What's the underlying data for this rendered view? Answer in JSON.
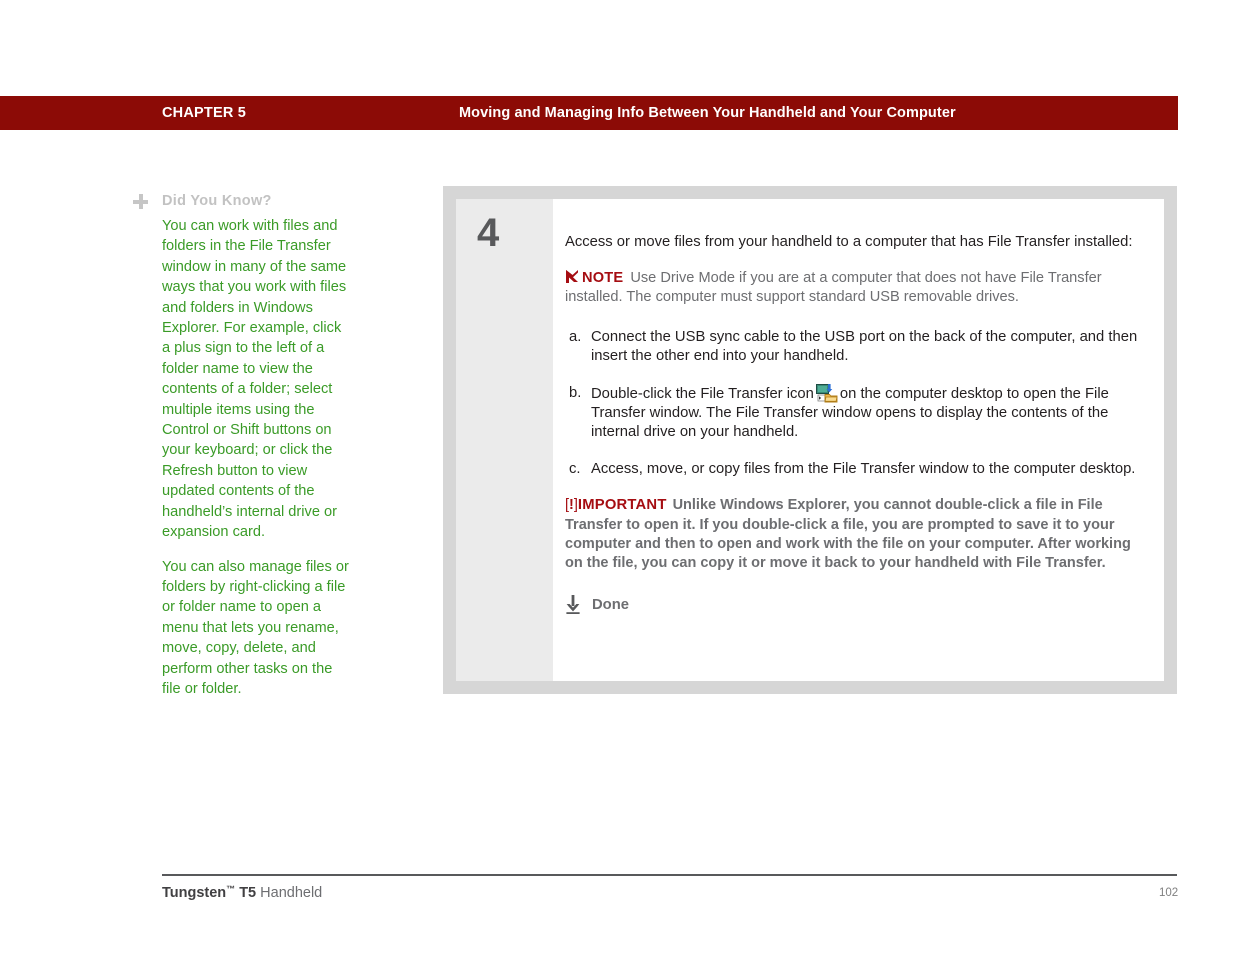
{
  "header": {
    "chapter": "CHAPTER 5",
    "title": "Moving and Managing Info Between Your Handheld and Your Computer",
    "bar_color": "#8c0b06"
  },
  "sidebar": {
    "icon": "plus-icon",
    "heading": "Did You Know?",
    "heading_color": "#c2c2c2",
    "text_color": "#3a9b27",
    "paragraphs": [
      "You can work with files and folders in the File Transfer window in many of the same ways that you work with files and folders in Windows Explorer. For example, click a plus sign to the left of a folder name to view the contents of a folder; select multiple items using the Control or Shift buttons on your keyboard; or click the Refresh button to view updated contents of the handheld’s internal drive or expansion card.",
      "You can also manage files or folders by right-clicking a file or folder name to open a menu that lets you rename, move, copy, delete, and perform other tasks on the file or folder."
    ]
  },
  "main": {
    "step_number": "4",
    "lead": "Access or move files from your handheld to a computer that has File Transfer installed:",
    "note": {
      "icon": "note-flag-icon",
      "label": "NOTE",
      "label_color": "#a50d12",
      "text": "Use Drive Mode if you are at a computer that does not have File Transfer installed. The computer must support standard USB removable drives."
    },
    "steps": [
      {
        "marker": "a.",
        "text": "Connect the USB sync cable to the USB port on the back of the computer, and then insert the other end into your handheld."
      },
      {
        "marker": "b.",
        "text_before": "Double-click the File Transfer icon",
        "icon": "file-transfer-icon",
        "text_after": "on the computer desktop to open the File Transfer window. The File Transfer window opens to display the contents of the internal drive on your handheld."
      },
      {
        "marker": "c.",
        "text": "Access, move, or copy files from the File Transfer window to the computer desktop."
      }
    ],
    "important": {
      "bracket_open": "[",
      "bang": "!",
      "bracket_close": "]",
      "label": "IMPORTANT",
      "label_color": "#a50d12",
      "text": "Unlike Windows Explorer, you cannot double-click a file in File Transfer to open it. If you double-click a file, you are prompted to save it to your computer and then to open and work with the file on your computer. After working on the file, you can copy it or move it back to your handheld with File Transfer."
    },
    "done": {
      "icon": "down-arrow-icon",
      "label": "Done"
    }
  },
  "footer": {
    "product": "Tungsten",
    "trademark": "™",
    "model": "T5",
    "product_type": "Handheld",
    "page_number": "102"
  }
}
